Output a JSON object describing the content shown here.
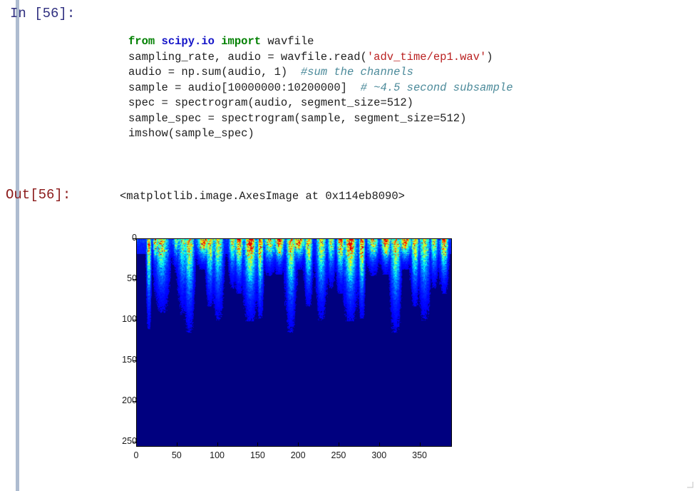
{
  "cell": {
    "input_prompt": "In [56]:",
    "output_prompt": "Out[56]:",
    "output_text": "<matplotlib.image.AxesImage at 0x114eb8090>"
  },
  "code": {
    "lines": [
      [
        {
          "t": "from ",
          "c": "kw"
        },
        {
          "t": "scipy.io ",
          "c": "mod"
        },
        {
          "t": "import ",
          "c": "kw"
        },
        {
          "t": "wavfile",
          "c": "plain"
        }
      ],
      [
        {
          "t": "sampling_rate, audio = wavfile.read(",
          "c": "plain"
        },
        {
          "t": "'adv_time/ep1.wav'",
          "c": "str"
        },
        {
          "t": ")",
          "c": "plain"
        }
      ],
      [
        {
          "t": "audio = np.sum(audio, 1)  ",
          "c": "plain"
        },
        {
          "t": "#sum the channels",
          "c": "com"
        }
      ],
      [
        {
          "t": "sample = audio[10000000:10200000]  ",
          "c": "plain"
        },
        {
          "t": "# ~4.5 second subsample",
          "c": "com"
        }
      ],
      [
        {
          "t": "spec = spectrogram(audio, segment_size=512)",
          "c": "plain"
        }
      ],
      [
        {
          "t": "sample_spec = spectrogram(sample, segment_size=512)",
          "c": "plain"
        }
      ],
      [
        {
          "t": "imshow(sample_spec)",
          "c": "plain"
        }
      ]
    ]
  },
  "chart_data": {
    "type": "heatmap",
    "title": "",
    "xlabel": "",
    "ylabel": "",
    "xticks": [
      "0",
      "50",
      "100",
      "150",
      "200",
      "250",
      "300",
      "350"
    ],
    "xtick_values": [
      0,
      50,
      100,
      150,
      200,
      250,
      300,
      350
    ],
    "yticks": [
      "0",
      "50",
      "100",
      "150",
      "200",
      "250"
    ],
    "ytick_values": [
      0,
      50,
      100,
      150,
      200,
      250
    ],
    "xlim": [
      0,
      390
    ],
    "ylim": [
      256,
      0
    ],
    "colormap": "jet",
    "background_color": "#00007f",
    "grid": false,
    "description": "Audio spectrogram: 256 frequency bins (rows, y axis inverted) by ~390 time segments (columns). Energy is concentrated in the low-index frequency bins at the top of the image, appearing as bright blue/cyan/yellow vertical streaks against a dark navy background; the lower two thirds of the plot is uniformly dark navy (near-zero magnitude).",
    "bright_column_centers": [
      14,
      22,
      30,
      48,
      56,
      64,
      82,
      90,
      100,
      118,
      126,
      140,
      152,
      164,
      176,
      190,
      200,
      212,
      228,
      240,
      252,
      264,
      278,
      292,
      308,
      320,
      332,
      344,
      356,
      368,
      380
    ],
    "peak_row_range": [
      0,
      60
    ]
  },
  "colors": {
    "gutter": "#aebcd0",
    "in_prompt": "#303080",
    "out_prompt": "#8b1a1a",
    "keyword": "#008000",
    "module": "#1414c8",
    "string": "#ba2121",
    "comment": "#4b8a9a",
    "plot_bg": "#00007f"
  }
}
